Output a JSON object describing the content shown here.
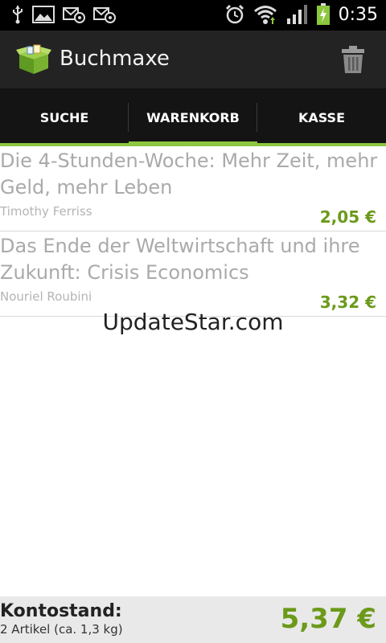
{
  "status_bar": {
    "time": "0:35",
    "left_icons": [
      "usb-icon",
      "image-icon",
      "email-icon",
      "email-icon"
    ],
    "right_icons": [
      "alarm-icon",
      "wifi-icon",
      "signal-icon",
      "battery-charging-icon"
    ]
  },
  "action_bar": {
    "title": "Buchmaxe",
    "logo_icon": "box-icon",
    "delete_icon": "trash-icon"
  },
  "tabs": [
    {
      "label": "SUCHE",
      "active": false
    },
    {
      "label": "WARENKORB",
      "active": true
    },
    {
      "label": "KASSE",
      "active": false
    }
  ],
  "items": [
    {
      "title": "Die 4-Stunden-Woche: Mehr Zeit, mehr Geld, mehr Leben",
      "author": "Timothy Ferriss",
      "price": "2,05 €"
    },
    {
      "title": "Das Ende der Weltwirtschaft und ihre Zukunft: Crisis Economics",
      "author": "Nouriel Roubini",
      "price": "3,32 €"
    }
  ],
  "watermark": "UpdateStar.com",
  "footer": {
    "label": "Kontostand:",
    "subtitle": "2 Artikel (ca. 1,3 kg)",
    "total": "5,37 €"
  },
  "colors": {
    "accent_green": "#8dc63f",
    "price_green": "#6b9a1a",
    "actionbar_bg": "#232323",
    "tabs_bg": "#141414"
  }
}
